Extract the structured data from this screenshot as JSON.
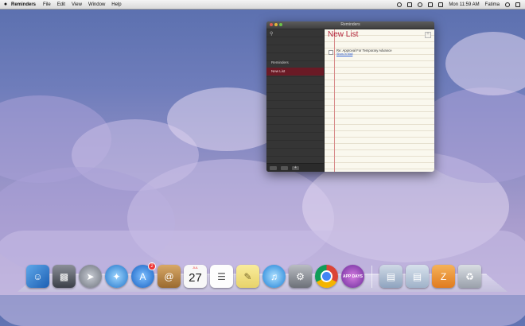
{
  "menubar": {
    "apple": "",
    "app_name": "Reminders",
    "menus": [
      "File",
      "Edit",
      "View",
      "Window",
      "Help"
    ],
    "clock": "Mon 11:59 AM",
    "user": "Fatima"
  },
  "window": {
    "title": "Reminders",
    "search_icon": "magnifier",
    "sidebar": {
      "header": "Reminders",
      "lists": [
        "New List"
      ],
      "selected": "New List",
      "bottom_buttons": [
        "calendar-icon",
        "calendar-icon",
        "+"
      ]
    },
    "list": {
      "title": "New List",
      "add_label": "+",
      "reminders": [
        {
          "text": "Re: Approval For Temporary Advance",
          "link": "Show in Mail"
        }
      ]
    },
    "colors": {
      "accent": "#b4233a",
      "selected": "#6a1a25",
      "paper": "#faf8ee"
    }
  },
  "dock": {
    "apps": [
      "finder-icon",
      "migration-icon",
      "launchpad-icon",
      "safari-icon",
      "app-store-icon",
      "contacts-icon",
      "calendar-icon",
      "reminders-icon",
      "notes-icon",
      "itunes-icon",
      "preferences-icon",
      "chrome-icon",
      "appdays-icon"
    ],
    "app_store_badge": "2",
    "calendar": {
      "month": "JUL",
      "day": "27"
    },
    "appdays_label": "APP DAYS",
    "right_items": [
      "documents-folder-icon",
      "downloads-folder-icon",
      "archive-icon",
      "trash-icon"
    ]
  }
}
